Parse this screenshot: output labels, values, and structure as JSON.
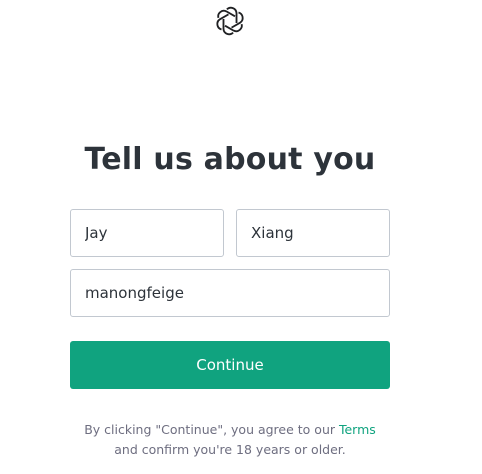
{
  "logo": {
    "icon": "openai-logo-icon"
  },
  "page": {
    "title": "Tell us about you"
  },
  "form": {
    "first_name": {
      "value": "Jay"
    },
    "last_name": {
      "value": "Xiang"
    },
    "username": {
      "value": "manongfeige"
    },
    "continue_label": "Continue"
  },
  "legal": {
    "prefix": "By clicking \"Continue\", you agree to our ",
    "terms_link": "Terms",
    "line2": "and confirm you're 18 years or older."
  },
  "colors": {
    "accent": "#10a37f",
    "text": "#2d333a",
    "muted": "#6e6e80",
    "border": "#c2c8d0"
  }
}
